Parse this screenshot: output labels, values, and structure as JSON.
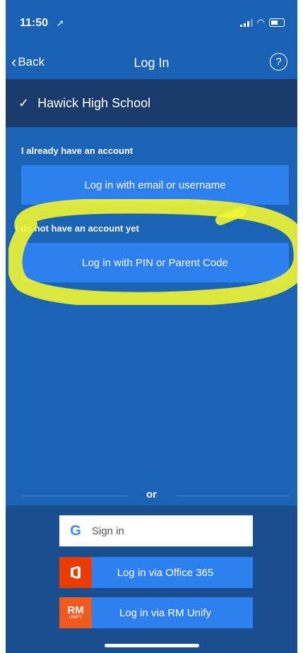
{
  "status": {
    "time": "11:50"
  },
  "nav": {
    "back_label": "Back",
    "title": "Log In",
    "help_symbol": "?"
  },
  "school": {
    "name": "Hawick High School"
  },
  "existing": {
    "label": "I already have an account",
    "button": "Log in with email or username"
  },
  "new_account": {
    "label": "I do not have an account yet",
    "button": "Log in with PIN or Parent Code"
  },
  "divider": {
    "or_label": "or"
  },
  "sso": {
    "google_label": "Sign in",
    "office_label": "Log in via Office 365",
    "rm_label": "Log in via RM Unify",
    "rm_logo_text": "RM",
    "rm_logo_sub": "UNIFY"
  },
  "colors": {
    "background": "#1b63b5",
    "school_bar": "#1a3a6b",
    "button": "#2e7ff0",
    "highlight": "#f2f531",
    "office_orange": "#eb3c00",
    "rm_orange": "#f05a1e"
  }
}
